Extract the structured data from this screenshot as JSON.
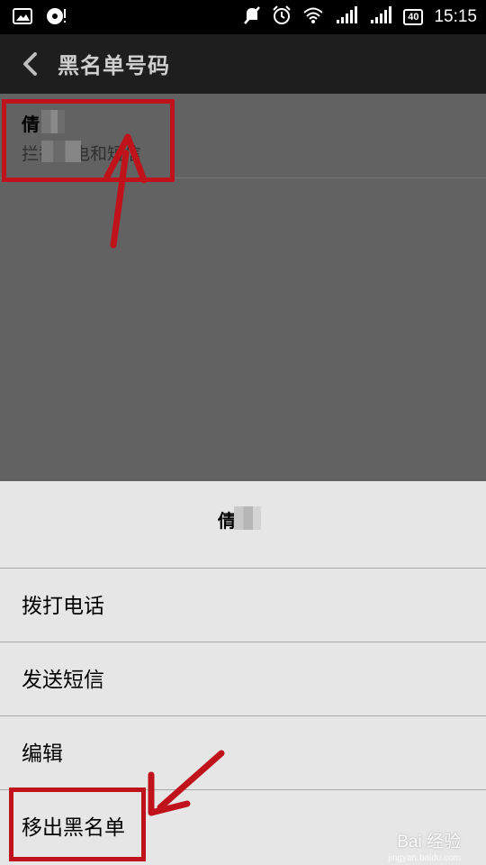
{
  "status_bar": {
    "time": "15:15",
    "battery": "40",
    "left_icons": [
      "image-icon",
      "sync-icon"
    ],
    "right_icons": [
      "mute-icon",
      "alarm-icon",
      "wifi-icon",
      "signal-icon",
      "signal-icon",
      "battery-icon"
    ]
  },
  "action_bar": {
    "title": "黑名单号码",
    "back_icon": "chevron-left-icon"
  },
  "blacklist": {
    "items": [
      {
        "name": "倩",
        "subtitle": "拦截来电和短信"
      }
    ]
  },
  "sheet": {
    "title": "倩",
    "items": [
      {
        "label": "拨打电话"
      },
      {
        "label": "发送短信"
      },
      {
        "label": "编辑"
      },
      {
        "label": "移出黑名单"
      }
    ]
  },
  "watermark": {
    "text": "Bai 经验",
    "sub": "jingyan.baidu.com"
  },
  "colors": {
    "highlight": "#c0121b",
    "sheet_bg": "#e6e6e6",
    "actionbar_bg": "#1e1e1e"
  }
}
